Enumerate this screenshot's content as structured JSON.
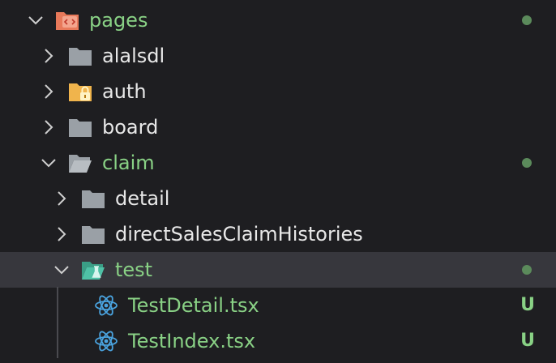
{
  "explorer": {
    "items": [
      {
        "label": "pages",
        "kind": "folder-open",
        "icon": "pages-folder-icon",
        "status": "dot"
      },
      {
        "label": "alalsdl",
        "kind": "folder",
        "icon": "folder-icon",
        "status": ""
      },
      {
        "label": "auth",
        "kind": "folder",
        "icon": "lock-folder-icon",
        "status": ""
      },
      {
        "label": "board",
        "kind": "folder",
        "icon": "folder-icon",
        "status": ""
      },
      {
        "label": "claim",
        "kind": "folder-open",
        "icon": "folder-open-icon",
        "status": "dot"
      },
      {
        "label": "detail",
        "kind": "folder",
        "icon": "folder-icon",
        "status": ""
      },
      {
        "label": "directSalesClaimHistories",
        "kind": "folder",
        "icon": "folder-icon",
        "status": ""
      },
      {
        "label": "test",
        "kind": "folder-open",
        "icon": "test-folder-open-icon",
        "status": "dot"
      },
      {
        "label": "TestDetail.tsx",
        "kind": "file",
        "icon": "react-icon",
        "status": "U"
      },
      {
        "label": "TestIndex.tsx",
        "kind": "file",
        "icon": "react-icon",
        "status": "U"
      }
    ]
  },
  "colors": {
    "background": "#1e1e21",
    "selected": "#37373d",
    "modified_text": "#89d185",
    "status_dot": "#5b8a5b",
    "folder_gray": "#9aa0a6",
    "pages_folder": "#e8795a",
    "auth_folder": "#f0b44c",
    "test_folder": "#4fc1a6",
    "react_blue": "#4aa3df"
  }
}
